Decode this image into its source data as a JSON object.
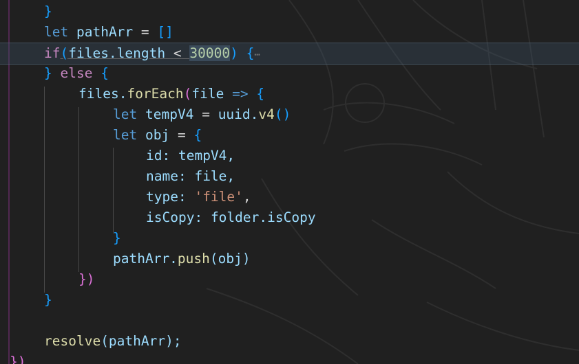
{
  "code_lines": [
    {
      "id": "l1",
      "tokens": [
        "}"
      ]
    },
    {
      "id": "l2",
      "tokens": [
        "let",
        "pathArr",
        "=",
        "[]"
      ]
    },
    {
      "id": "l3",
      "tokens": [
        "if",
        "(",
        "files.length",
        "<",
        "30000",
        ")",
        "{",
        "⋯"
      ]
    },
    {
      "id": "l4",
      "tokens": [
        "}",
        "else",
        "{"
      ]
    },
    {
      "id": "l5",
      "tokens": [
        "files.",
        "forEach",
        "(",
        "file",
        "=>",
        "{"
      ]
    },
    {
      "id": "l6",
      "tokens": [
        "let",
        "tempV4",
        "=",
        "uuid.",
        "v4",
        "()"
      ]
    },
    {
      "id": "l7",
      "tokens": [
        "let",
        "obj",
        "=",
        "{"
      ]
    },
    {
      "id": "l8",
      "tokens": [
        "id:",
        "tempV4,"
      ]
    },
    {
      "id": "l9",
      "tokens": [
        "name:",
        "file,"
      ]
    },
    {
      "id": "l10",
      "tokens": [
        "type:",
        "'file'",
        ","
      ]
    },
    {
      "id": "l11",
      "tokens": [
        "isCopy:",
        "folder.isCopy"
      ]
    },
    {
      "id": "l12",
      "tokens": [
        "}"
      ]
    },
    {
      "id": "l13",
      "tokens": [
        "pathArr.",
        "push",
        "(obj)"
      ]
    },
    {
      "id": "l14",
      "tokens": [
        "})"
      ]
    },
    {
      "id": "l15",
      "tokens": [
        "}"
      ]
    },
    {
      "id": "l16",
      "tokens": []
    },
    {
      "id": "l17",
      "tokens": [
        "resolve",
        "(pathArr);"
      ]
    },
    {
      "id": "l18",
      "tokens": [
        "})"
      ]
    }
  ],
  "colors": {
    "background": "#202020",
    "keyword": "#569cd6",
    "control": "#c586c0",
    "variable": "#9cdcfe",
    "function": "#dcdcaa",
    "number": "#b5cea8",
    "string": "#ce9178",
    "bracket_gold": "#ffd700",
    "bracket_purple": "#da70d6",
    "bracket_blue": "#179fff"
  }
}
